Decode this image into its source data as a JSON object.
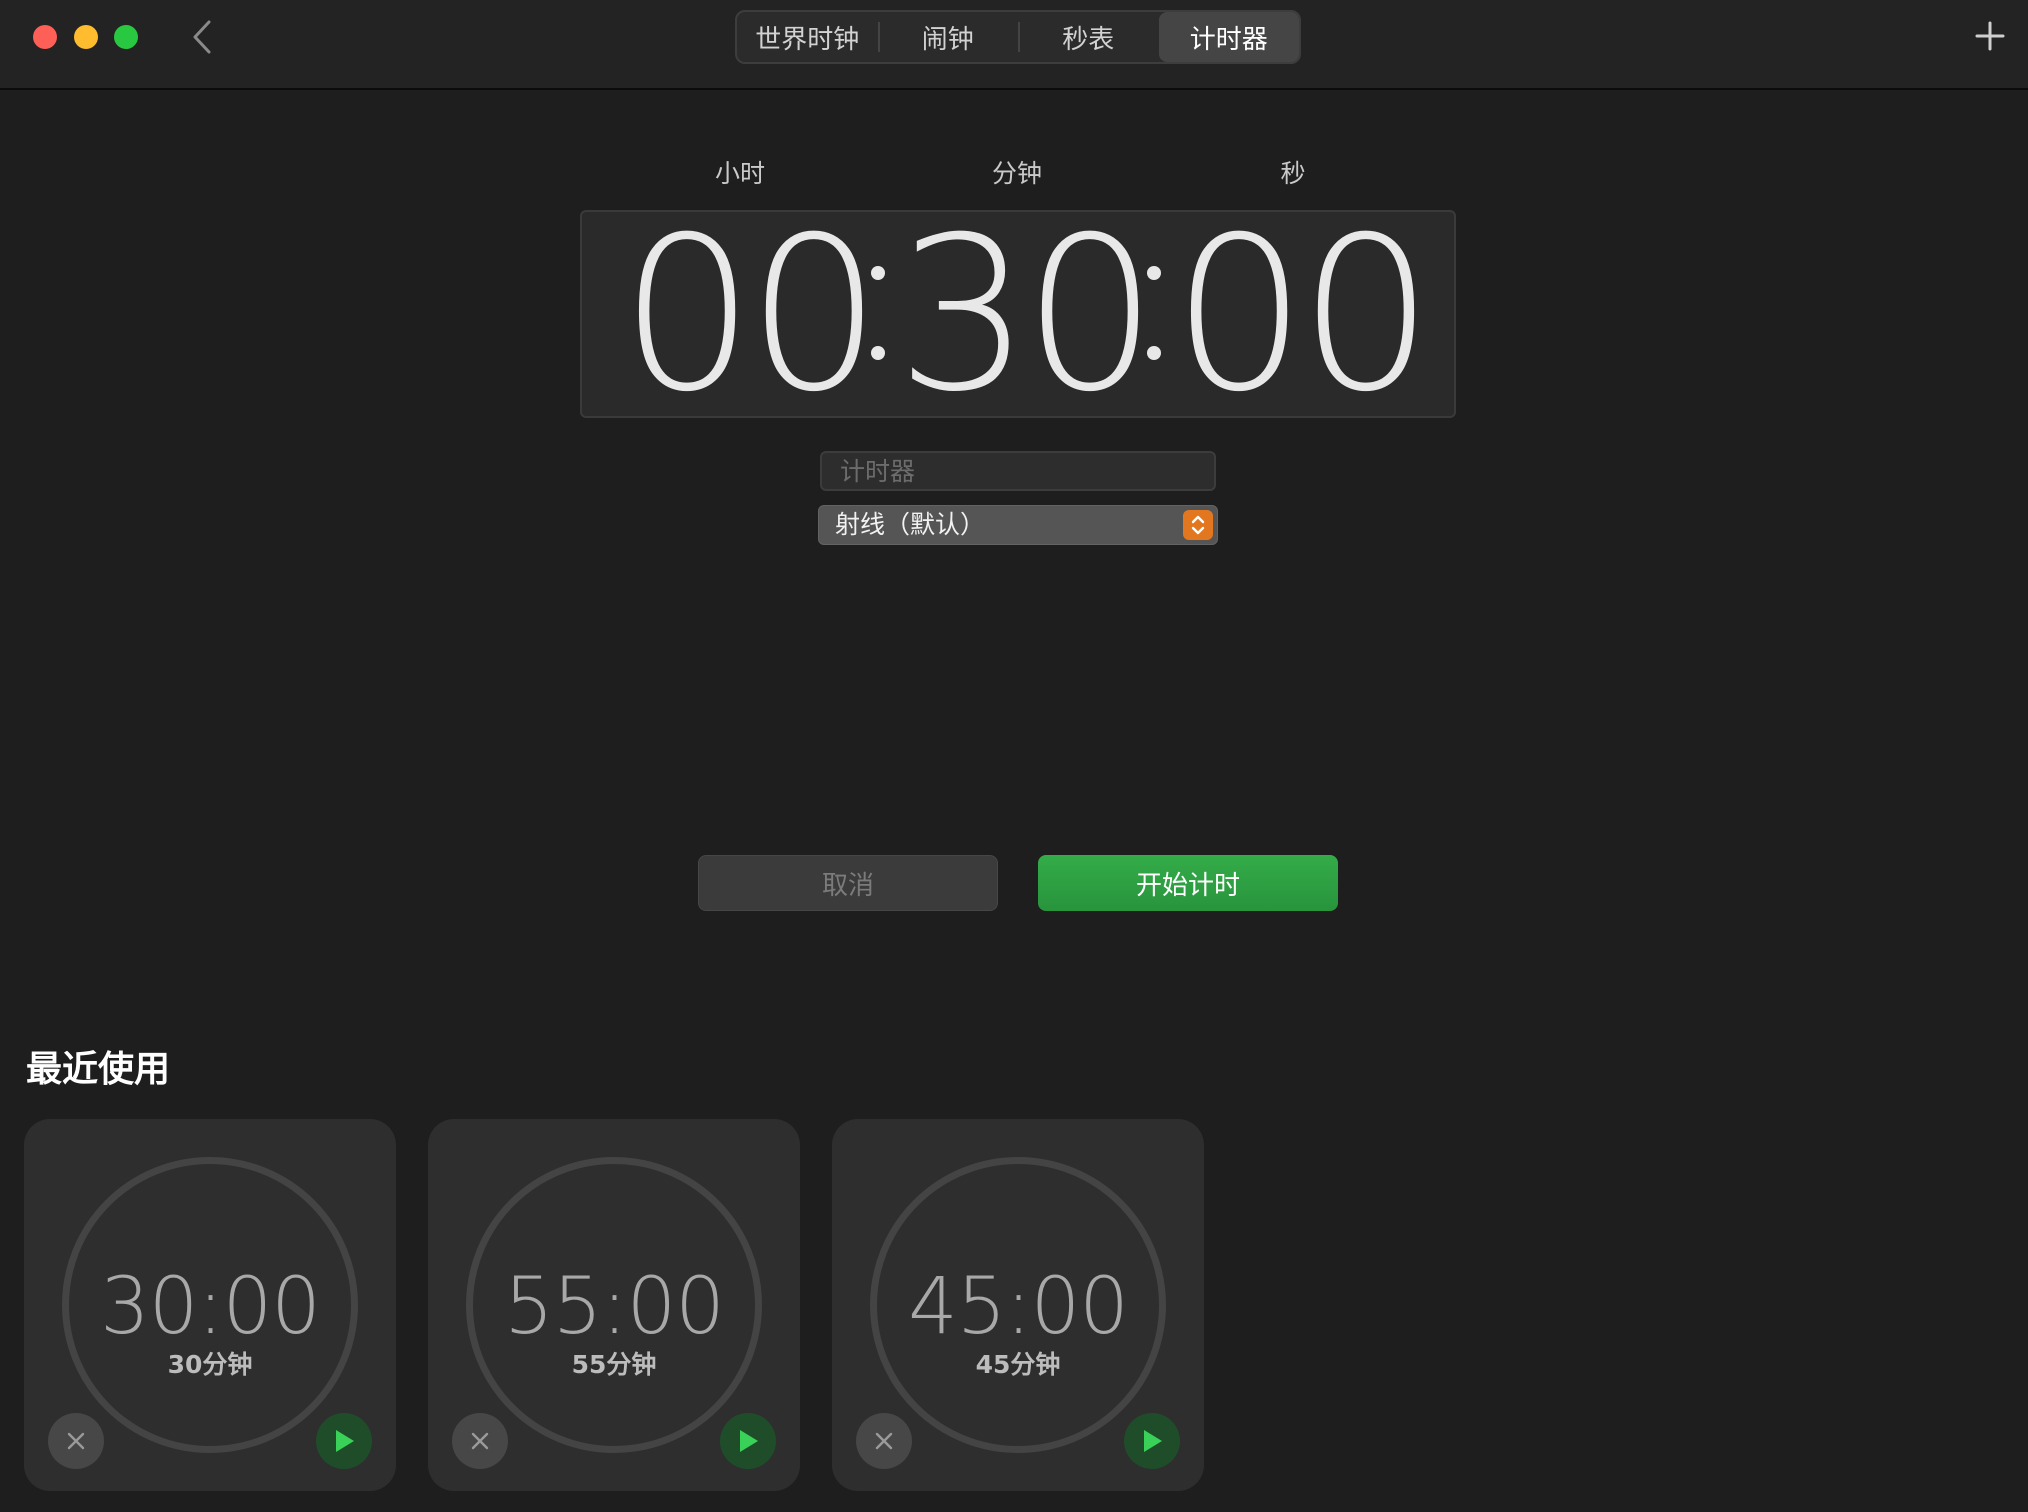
{
  "tabs": [
    {
      "label": "世界时钟"
    },
    {
      "label": "闹钟"
    },
    {
      "label": "秒表"
    },
    {
      "label": "计时器",
      "active": true
    }
  ],
  "picker": {
    "hours_label": "小时",
    "minutes_label": "分钟",
    "seconds_label": "秒",
    "hours": "00",
    "minutes": "30",
    "seconds": "00"
  },
  "label_field": {
    "value": "",
    "placeholder": "计时器"
  },
  "sound_select": {
    "selected": "射线（默认）"
  },
  "buttons": {
    "cancel": "取消",
    "start": "开始计时"
  },
  "recent": {
    "title": "最近使用",
    "items": [
      {
        "time": "30:00",
        "label": "30分钟"
      },
      {
        "time": "55:00",
        "label": "55分钟"
      },
      {
        "time": "45:00",
        "label": "45分钟"
      }
    ]
  },
  "colors": {
    "accent_green": "#2ea043",
    "select_stepper": "#e3771f",
    "background": "#1e1e1e"
  },
  "icons": [
    "close-window-icon",
    "minimize-window-icon",
    "zoom-window-icon",
    "chevron-left-icon",
    "plus-icon",
    "chevron-up-down-icon",
    "close-icon",
    "play-icon"
  ]
}
